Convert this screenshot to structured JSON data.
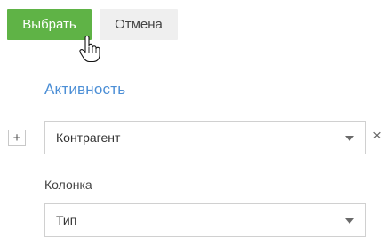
{
  "buttons": {
    "select_label": "Выбрать",
    "cancel_label": "Отмена"
  },
  "section": {
    "title": "Активность"
  },
  "filter": {
    "add_symbol": "+",
    "object_value": "Контрагент",
    "remove_symbol": "×"
  },
  "column": {
    "label": "Колонка",
    "value": "Тип"
  },
  "colors": {
    "primary": "#5fb346",
    "accent_title": "#4c8fd6"
  }
}
